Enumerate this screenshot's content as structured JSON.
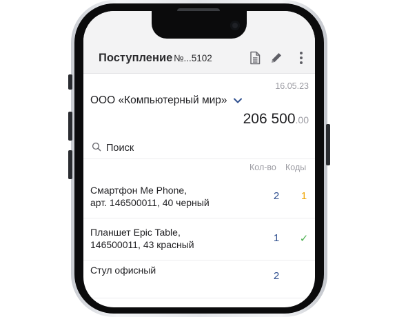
{
  "header": {
    "title": "Поступление",
    "number": "№...5102",
    "icons": [
      "document-icon",
      "edit-pencil-icon",
      "more-vertical-icon"
    ]
  },
  "document": {
    "date": "16.05.23",
    "supplier": "ООО «Компьютерный мир»",
    "amount_main": "206 500",
    "amount_cents": ".00"
  },
  "search": {
    "placeholder": "Поиск"
  },
  "columns": {
    "qty": "Кол-во",
    "codes": "Коды"
  },
  "items": [
    {
      "name": "Смартфон Me Phone,\nарт. 146500011, 40 черный",
      "qty": "2",
      "codes": "1",
      "codes_color": "#f0a500"
    },
    {
      "name": "Планшет Epic Table,\n146500011, 43 красный",
      "qty": "1",
      "codes": "✓",
      "codes_color": "#4cb050"
    },
    {
      "name": "Стул офисный",
      "qty": "2",
      "codes": "",
      "codes_color": "#4cb050"
    }
  ],
  "colors": {
    "accent": "#2f4f8f",
    "codes_pending": "#f0a500",
    "codes_done": "#4cb050",
    "muted_text": "#9c9ca3"
  }
}
